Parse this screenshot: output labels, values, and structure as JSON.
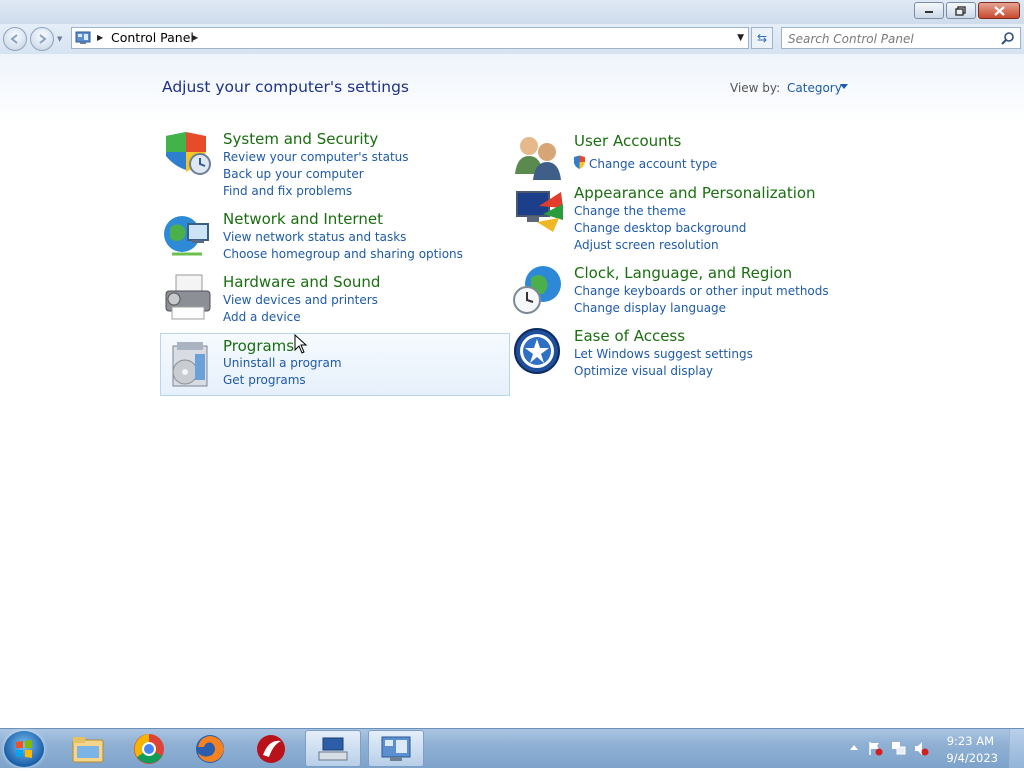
{
  "window": {
    "minimize_icon": "minimize-icon",
    "maximize_icon": "restore-icon",
    "close_icon": "close-icon"
  },
  "nav": {
    "breadcrumb": "Control Panel",
    "search_placeholder": "Search Control Panel"
  },
  "page": {
    "title": "Adjust your computer's settings",
    "view_by_label": "View by:",
    "view_by_value": "Category"
  },
  "categories": {
    "system": {
      "title": "System and Security",
      "icon": "shield-icon",
      "links": [
        "Review your computer's status",
        "Back up your computer",
        "Find and fix problems"
      ]
    },
    "network": {
      "title": "Network and Internet",
      "icon": "network-globe-icon",
      "links": [
        "View network status and tasks",
        "Choose homegroup and sharing options"
      ]
    },
    "hardware": {
      "title": "Hardware and Sound",
      "icon": "printer-icon",
      "links": [
        "View devices and printers",
        "Add a device"
      ]
    },
    "programs": {
      "title": "Programs",
      "icon": "programs-icon",
      "links": [
        "Uninstall a program",
        "Get programs"
      ]
    },
    "users": {
      "title": "User Accounts",
      "icon": "users-icon",
      "links": [
        "Change account type"
      ]
    },
    "appearance": {
      "title": "Appearance and Personalization",
      "icon": "monitor-palette-icon",
      "links": [
        "Change the theme",
        "Change desktop background",
        "Adjust screen resolution"
      ]
    },
    "clock": {
      "title": "Clock, Language, and Region",
      "icon": "clock-globe-icon",
      "links": [
        "Change keyboards or other input methods",
        "Change display language"
      ]
    },
    "access": {
      "title": "Ease of Access",
      "icon": "ease-of-access-icon",
      "links": [
        "Let Windows suggest settings",
        "Optimize visual display"
      ]
    }
  },
  "taskbar": {
    "apps": [
      "windows-explorer-icon",
      "chrome-icon",
      "firefox-icon",
      "app-red-icon",
      "keyboard-app-icon",
      "control-panel-icon"
    ],
    "time": "9:23 AM",
    "date": "9/4/2023"
  },
  "colors": {
    "link": "#1e5aa8",
    "category_title": "#196e0f",
    "page_title": "#1e3287"
  }
}
